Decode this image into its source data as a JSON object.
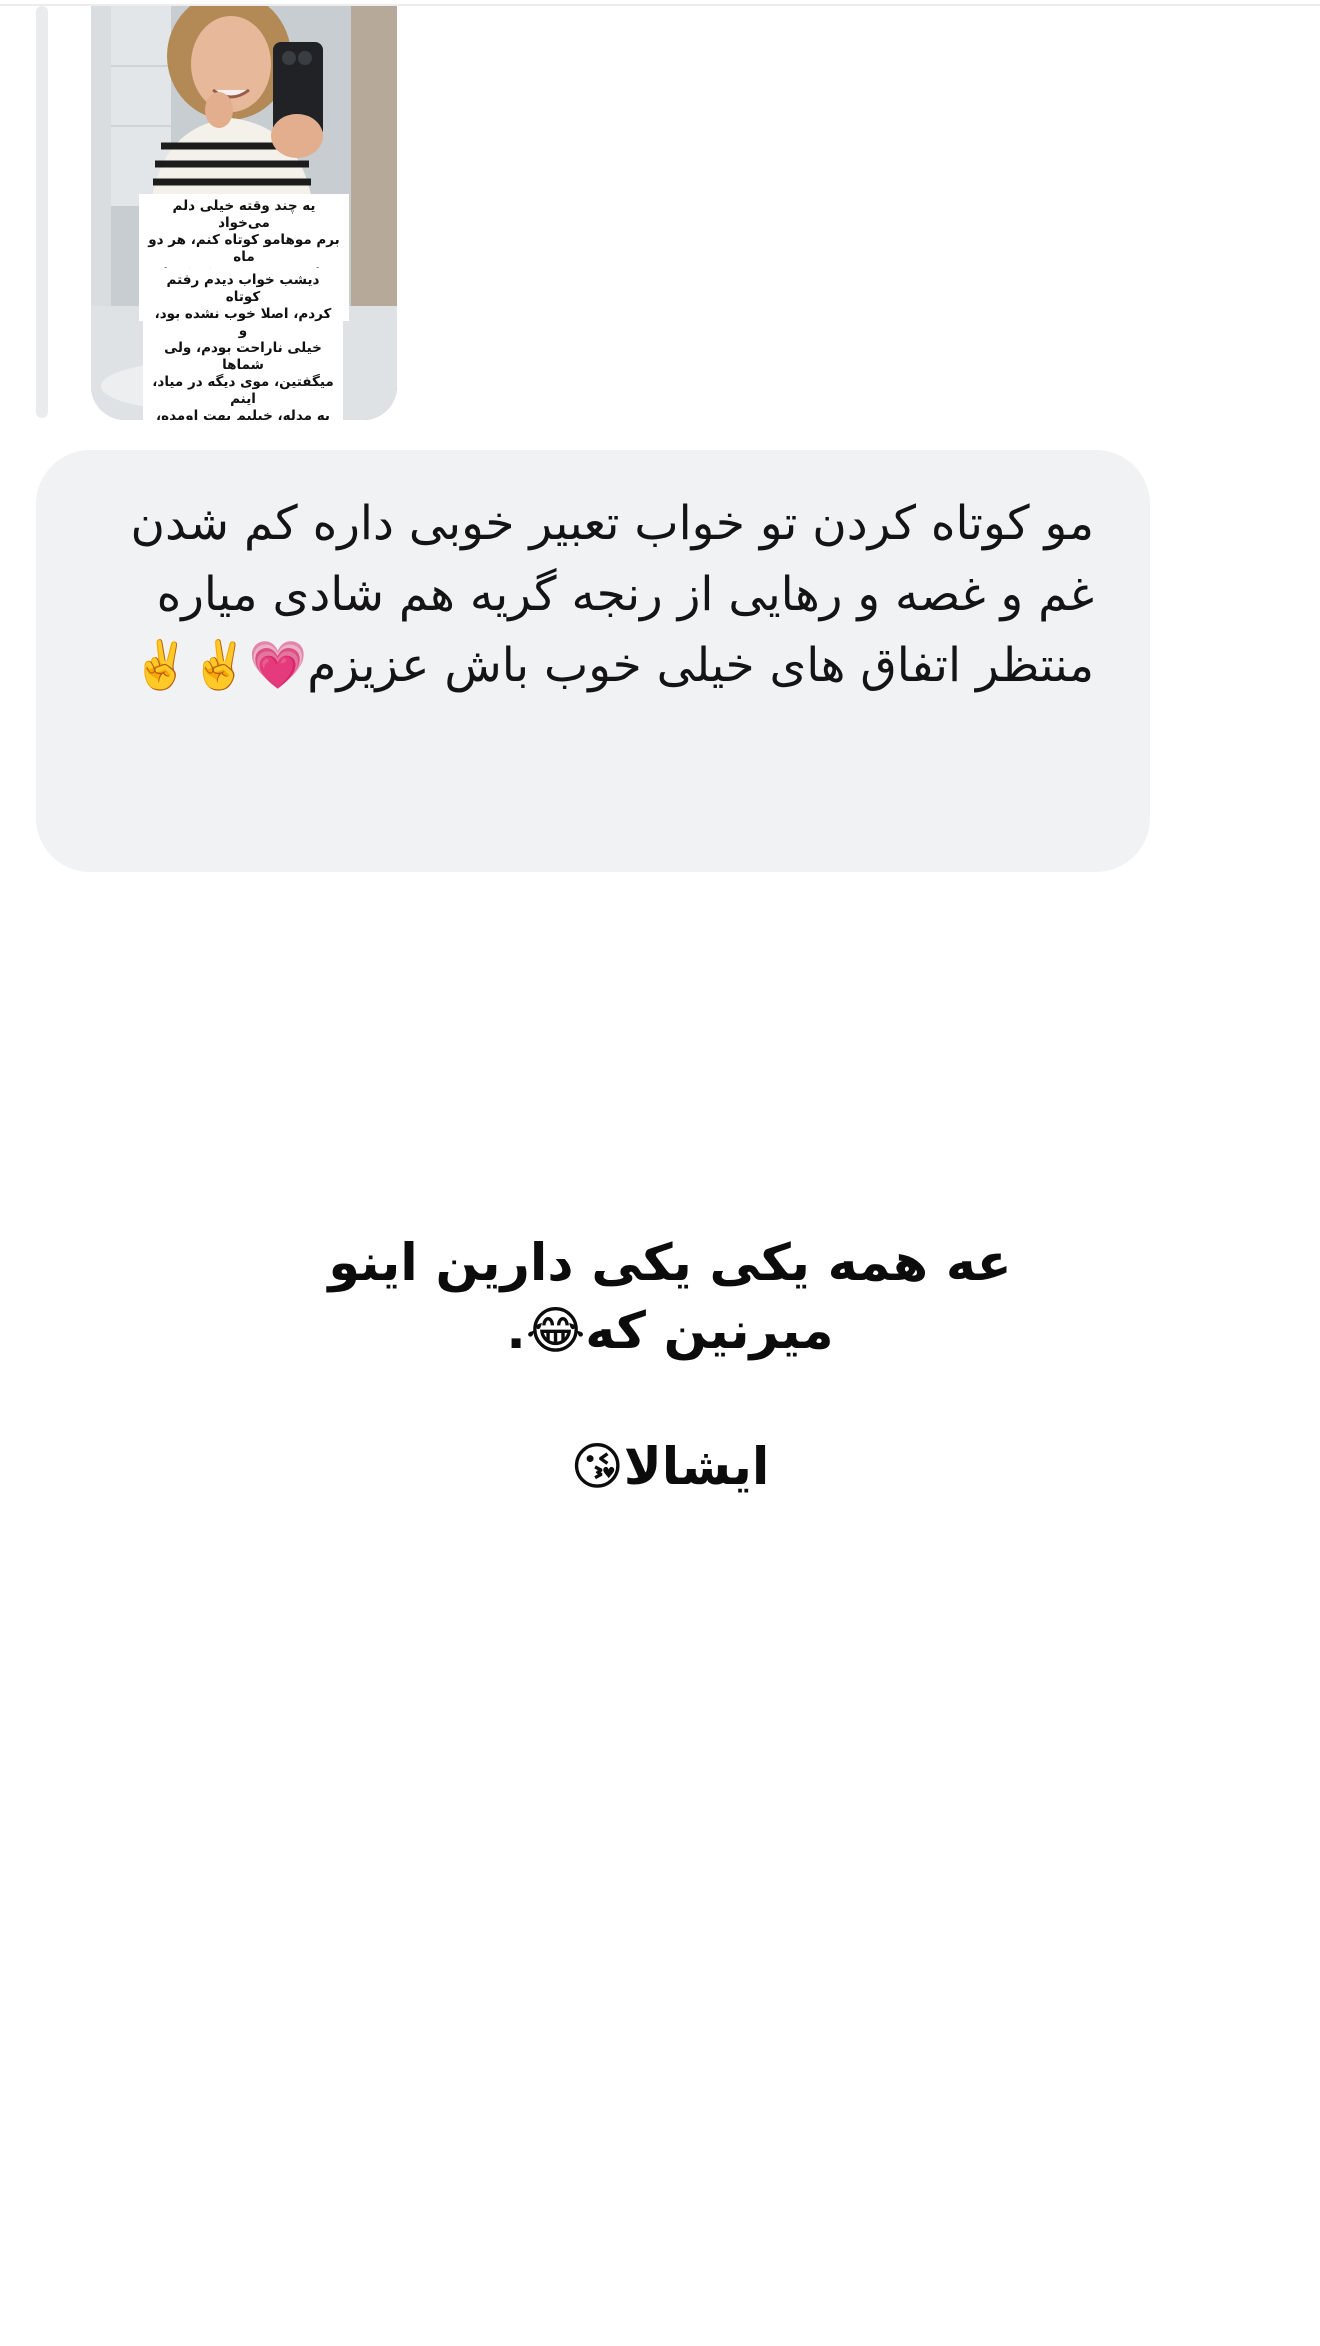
{
  "story_reply": {
    "caption_top": "یه چند وقته خیلی دلم می‌خواد\nبرم موهامو کوتاه کنم، هر دو ماه\nنظرم عوض میشه که کوتاه کنم\nیا نه😅",
    "caption_bottom": "دیشب خواب دیدم رفتم کوتاه\nکردم، اصلا خوب نشده بود، و\nخیلی ناراحت بودم، ولی شماها\nمیگفتین، موی دیگه در میاد، اینم\nیه مدله، خیلیم بهت اومده،\nخلاصه فقط بهم انرژی دادین\n..."
  },
  "message": {
    "text": "مو کوتاه کردن تو خواب تعبیر خوبی داره کم شدن غم و غصه و رهایی از رنجه گریه هم شادی میاره\nمنتظر اتفاق های خیلی خوب باش عزیزم💗✌️✌️",
    "bubble_color": "#f1f2f4"
  },
  "story_text": {
    "line_1": "عه همه یکی یکی دارین اینو میرنین که😂.",
    "line_2": "ایشالا😘"
  }
}
